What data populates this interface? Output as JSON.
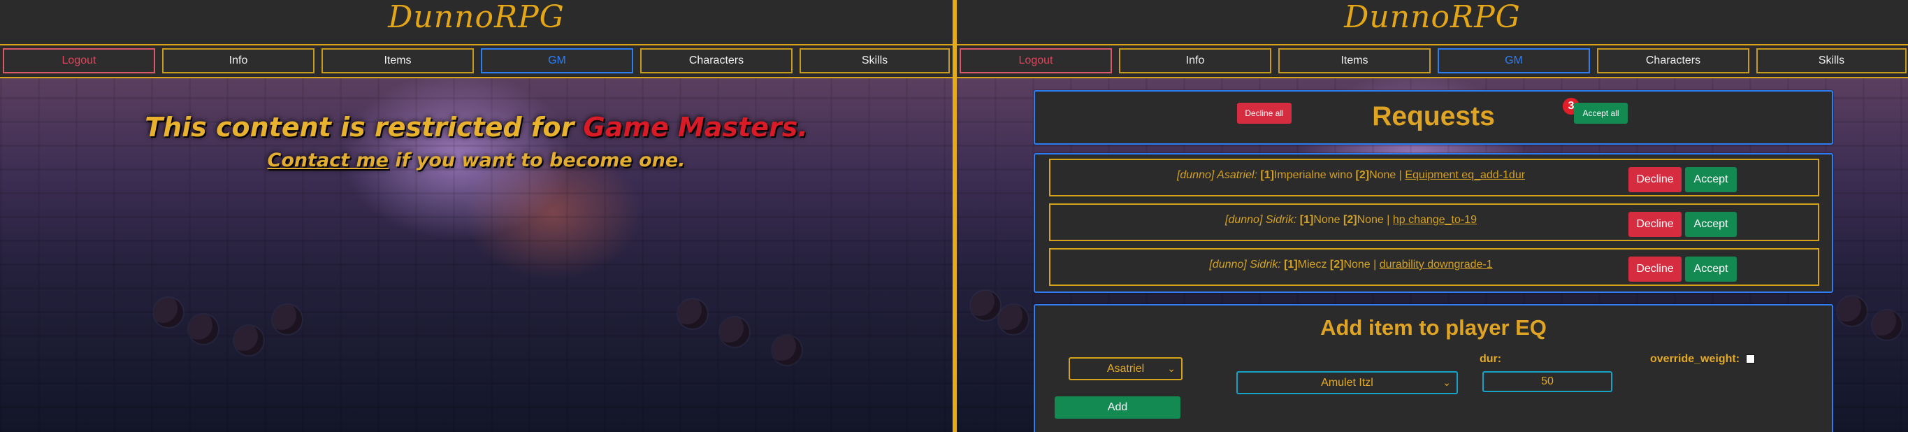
{
  "left": {
    "brand": "DunnoRPG",
    "nav": [
      "Logout",
      "Info",
      "Items",
      "GM",
      "Characters",
      "Skills"
    ],
    "restricted": {
      "title_prefix": "This content is restricted for ",
      "title_highlight": "Game Masters.",
      "contact_link": "Contact me",
      "contact_suffix": " if you want to become one."
    }
  },
  "right": {
    "brand": "DunnoRPG",
    "nav": [
      "Logout",
      "Info",
      "Items",
      "GM",
      "Characters",
      "Skills"
    ],
    "requests": {
      "title": "Requests",
      "count": "3",
      "decline_all": "Decline all",
      "accept_all": "Accept all",
      "items": [
        {
          "user": "[dunno] Asatriel:",
          "b1": "[1]",
          "v1": "Imperialne wino",
          "b2": "[2]",
          "v2": "None",
          "sep": " | ",
          "link": "Equipment eq_add-1dur",
          "decline": "Decline",
          "accept": "Accept"
        },
        {
          "user": "[dunno] Sidrik:",
          "b1": "[1]",
          "v1": "None",
          "b2": "[2]",
          "v2": "None",
          "sep": " | ",
          "link": "hp change_to-19",
          "decline": "Decline",
          "accept": "Accept"
        },
        {
          "user": "[dunno] Sidrik:",
          "b1": "[1]",
          "v1": "Miecz",
          "b2": "[2]",
          "v2": "None",
          "sep": " | ",
          "link": "durability downgrade-1",
          "decline": "Decline",
          "accept": "Accept"
        }
      ]
    },
    "add_item": {
      "title": "Add item to player EQ",
      "player_value": "Asatriel",
      "item_value": "Amulet Itzl",
      "dur_label": "dur:",
      "dur_value": "50",
      "override_label": "override_weight:",
      "add_button": "Add"
    }
  }
}
